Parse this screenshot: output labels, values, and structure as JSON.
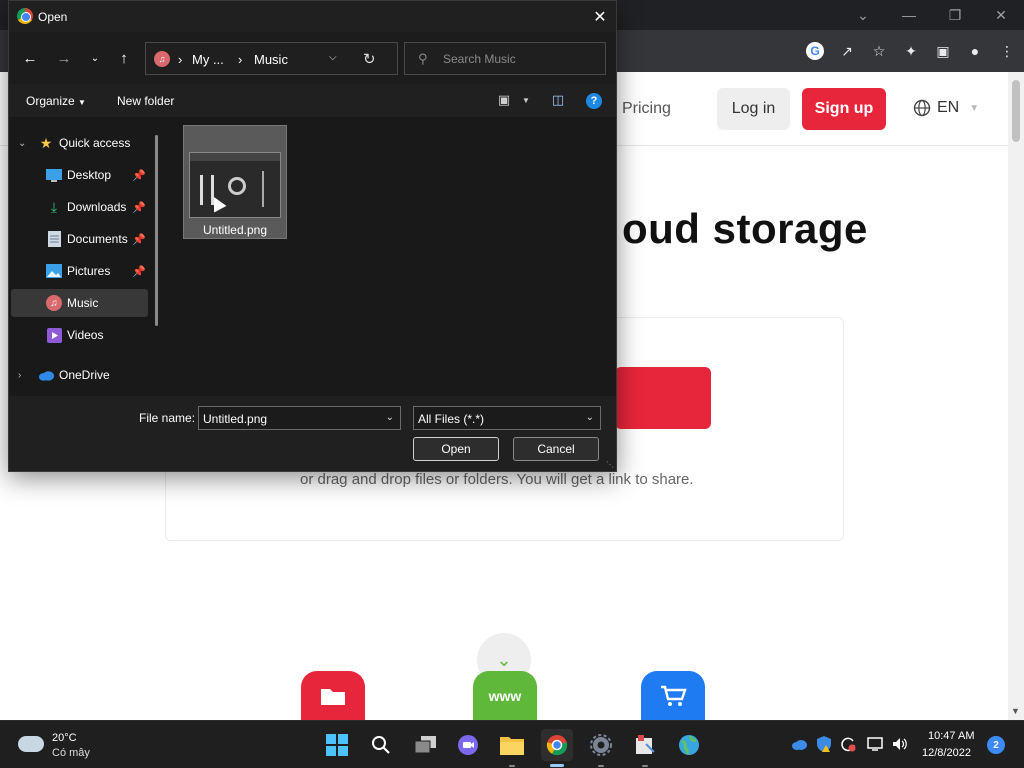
{
  "dialog": {
    "title": "Open",
    "address": {
      "segments": [
        "My ...",
        "Music"
      ]
    },
    "search": {
      "placeholder": "Search Music"
    },
    "commands": {
      "organize": "Organize",
      "new_folder": "New folder"
    },
    "nav_items": [
      {
        "label": "Quick access",
        "icon": "star-icon"
      },
      {
        "label": "Desktop",
        "icon": "desktop-icon",
        "pinned": true
      },
      {
        "label": "Downloads",
        "icon": "download-icon",
        "pinned": true
      },
      {
        "label": "Documents",
        "icon": "document-icon",
        "pinned": true
      },
      {
        "label": "Pictures",
        "icon": "pictures-icon",
        "pinned": true
      },
      {
        "label": "Music",
        "icon": "music-icon",
        "selected": true
      },
      {
        "label": "Videos",
        "icon": "videos-icon"
      },
      {
        "label": "OneDrive",
        "icon": "cloud-icon"
      }
    ],
    "files": [
      {
        "name": "Untitled.png"
      }
    ],
    "file_name_label": "File name:",
    "file_name_value": "Untitled.png",
    "file_type": "All Files (*.*)",
    "open_label": "Open",
    "cancel_label": "Cancel"
  },
  "site": {
    "nav_pricing": "Pricing",
    "login_label": "Log in",
    "signup_label": "Sign up",
    "language": "EN",
    "hero_title_partial": "oud storage",
    "upload_hint": "or drag and drop files or folders. You will get a link to share.",
    "tile_www": "www"
  },
  "taskbar": {
    "weather_temp": "20°C",
    "weather_condition": "Có mây",
    "time": "10:47 AM",
    "date": "12/8/2022",
    "notification_count": "2"
  },
  "colors": {
    "accent_red": "#e8263b",
    "accent_green": "#5fb83a",
    "accent_blue": "#1e7bf2",
    "dialog_bg": "#191919"
  }
}
